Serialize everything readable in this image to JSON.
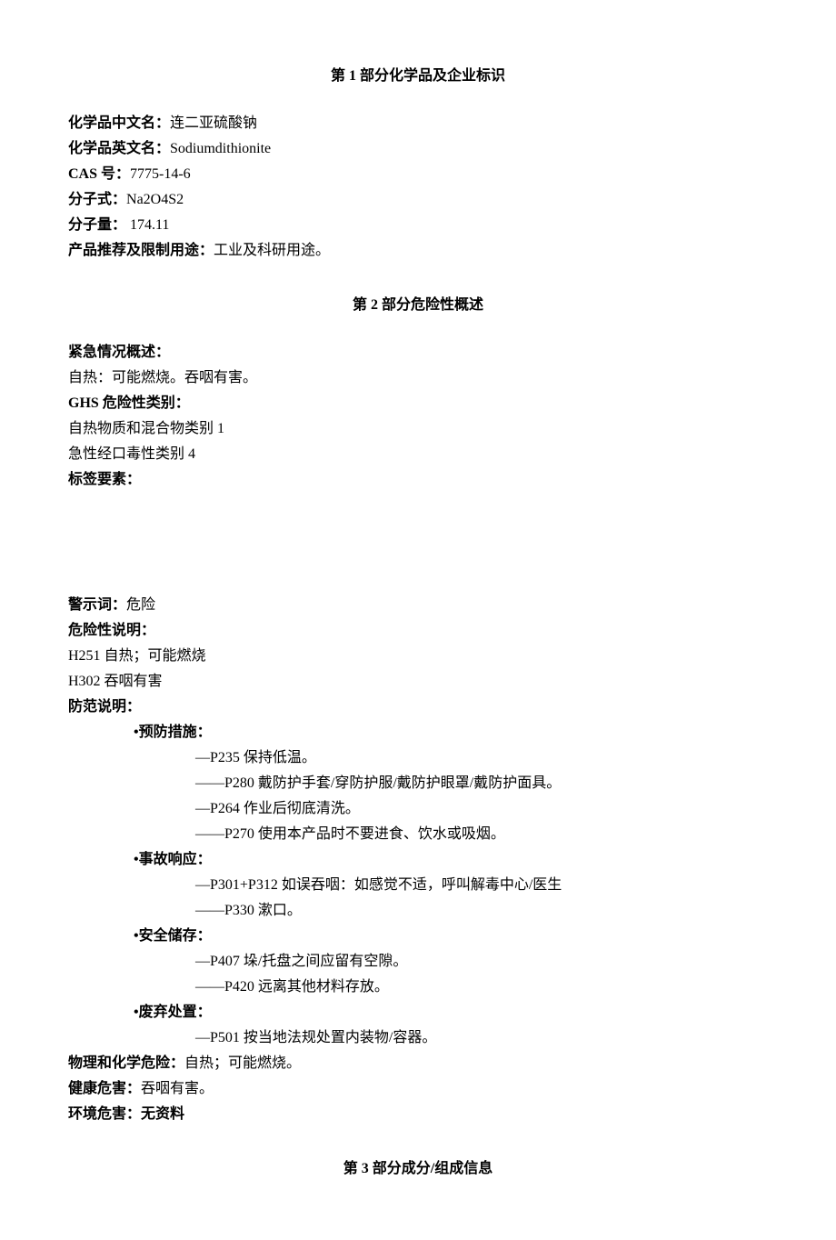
{
  "section1": {
    "title": "第 1 部分化学品及企业标识",
    "fields": {
      "name_cn_label": "化学品中文名：",
      "name_cn_value": "连二亚硫酸钠",
      "name_en_label": "化学品英文名：",
      "name_en_value": "Sodiumdithionite",
      "cas_label": "CAS 号：",
      "cas_value": "7775-14-6",
      "formula_label": "分子式：",
      "formula_value": "Na2O4S2",
      "mw_label": "分子量：",
      "mw_value": " 174.11",
      "use_label": "产品推荐及限制用途：",
      "use_value": "工业及科研用途。"
    }
  },
  "section2": {
    "title": "第 2 部分危险性概述",
    "emergency_label": "紧急情况概述：",
    "emergency_text": "自热：可能燃烧。吞咽有害。",
    "ghs_label": "GHS 危险性类别：",
    "ghs_lines": [
      "自热物质和混合物类别 1",
      "急性经口毒性类别 4"
    ],
    "label_elements": "标签要素：",
    "signal_label": "警示词：",
    "signal_value": "危险",
    "hazard_label": "危险性说明：",
    "hazard_lines": [
      "H251 自热；可能燃烧",
      "H302 吞咽有害"
    ],
    "precaution_label": "防范说明：",
    "prevention": {
      "heading": "•预防措施：",
      "items": [
        "—P235 保持低温。",
        "——P280 戴防护手套/穿防护服/戴防护眼罩/戴防护面具。",
        "—P264 作业后彻底清洗。",
        "——P270 使用本产品时不要进食、饮水或吸烟。"
      ]
    },
    "response": {
      "heading": "•事故响应：",
      "items": [
        "—P301+P312 如误吞咽：如感觉不适，呼叫解毒中心/医生",
        "——P330 漱口。"
      ]
    },
    "storage": {
      "heading": "•安全储存：",
      "items": [
        "—P407 垛/托盘之间应留有空隙。",
        "——P420 远离其他材料存放。"
      ]
    },
    "disposal": {
      "heading": "•废弃处置：",
      "items": [
        "—P501 按当地法规处置内装物/容器。"
      ]
    },
    "phys_label": "物理和化学危险：",
    "phys_value": "自热；可能燃烧。",
    "health_label": "健康危害：",
    "health_value": "吞咽有害。",
    "env_label": "环境危害：",
    "env_value": "无资料"
  },
  "section3": {
    "title": "第 3 部分成分/组成信息"
  }
}
